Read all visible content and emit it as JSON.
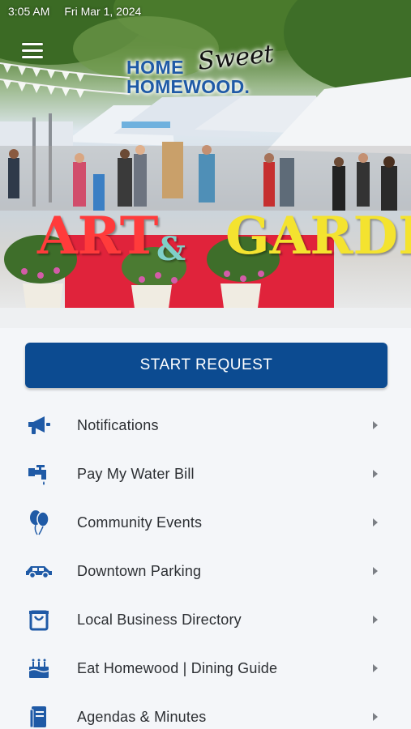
{
  "status_bar": {
    "time": "3:05 AM",
    "date": "Fri Mar 1, 2024"
  },
  "header": {
    "menu_icon": "hamburger-menu-icon",
    "logo": {
      "line1": "HOME",
      "script": "Sweet",
      "line2": "HOMEWOOD."
    },
    "banner_sign": {
      "word1": "ART",
      "amp": "&",
      "word2": "GARDE"
    }
  },
  "colors": {
    "primary": "#0c4b91",
    "icon": "#1f5aa6",
    "text": "#2c2f33",
    "background": "#f4f6f9"
  },
  "start_request": {
    "label": "START REQUEST"
  },
  "menu": {
    "items": [
      {
        "label": "Notifications",
        "icon": "megaphone-icon"
      },
      {
        "label": "Pay My Water Bill",
        "icon": "water-faucet-icon"
      },
      {
        "label": "Community Events",
        "icon": "balloons-icon"
      },
      {
        "label": "Downtown Parking",
        "icon": "car-icon"
      },
      {
        "label": "Local Business Directory",
        "icon": "shopping-bag-icon"
      },
      {
        "label": "Eat Homewood | Dining Guide",
        "icon": "cake-icon"
      },
      {
        "label": "Agendas & Minutes",
        "icon": "books-icon"
      }
    ]
  }
}
